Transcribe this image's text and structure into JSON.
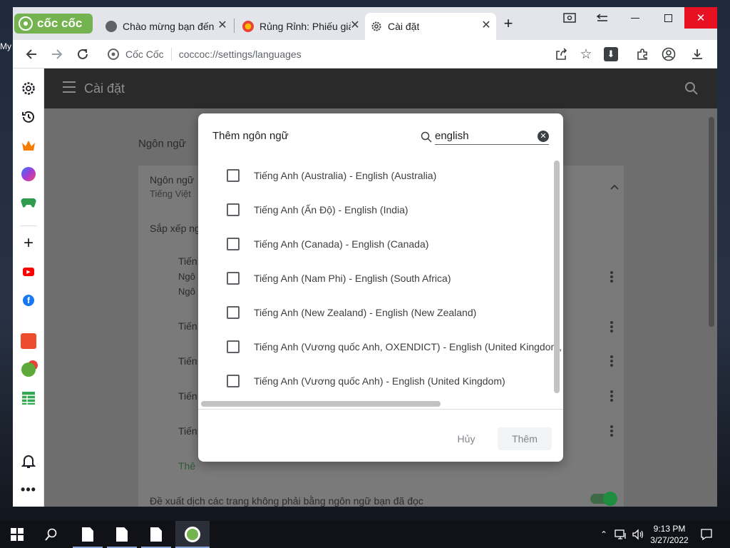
{
  "desktop": {
    "label": "My"
  },
  "tabs": {
    "brand": "cốc cốc",
    "items": [
      {
        "title": "Chào mừng bạn đến",
        "active": false
      },
      {
        "title": "Rủng Rỉnh: Phiếu giả",
        "active": false
      },
      {
        "title": "Cài đặt",
        "active": true
      }
    ]
  },
  "toolbar": {
    "omni_brand": "Cốc Cốc",
    "url": "coccoc://settings/languages"
  },
  "settings": {
    "title": "Cài đặt",
    "section_title": "Ngôn ngữ",
    "card_title": "Ngôn ngữ",
    "card_subtitle": "Tiếng Việt",
    "reorder_label": "Sắp xếp ng",
    "row1_line1": "Tiến",
    "row1_line2": "Ngô",
    "row1_line3": "Ngô",
    "row2": "Tiến",
    "row3": "Tiến",
    "row4": "Tiến",
    "row5": "Tiến",
    "add_link": "Thê",
    "translate_offer": "Đề xuất dịch các trang không phải bằng ngôn ngữ bạn đã đọc"
  },
  "dialog": {
    "title": "Thêm ngôn ngữ",
    "search_value": "english",
    "languages": [
      "Tiếng Anh (Australia) - English (Australia)",
      "Tiếng Anh (Ấn Độ) - English (India)",
      "Tiếng Anh (Canada) - English (Canada)",
      "Tiếng Anh (Nam Phi) - English (South Africa)",
      "Tiếng Anh (New Zealand) - English (New Zealand)",
      "Tiếng Anh (Vương quốc Anh, OXENDICT) - English (United Kingdom,",
      "Tiếng Anh (Vương quốc Anh) - English (United Kingdom)"
    ],
    "cancel_label": "Hủy",
    "add_label": "Thêm"
  },
  "taskbar": {
    "time": "9:13 PM",
    "date": "3/27/2022"
  },
  "colors": {
    "brand_green": "#74b34f",
    "close_red": "#e81123",
    "toggle_green": "#1e8e3e"
  }
}
